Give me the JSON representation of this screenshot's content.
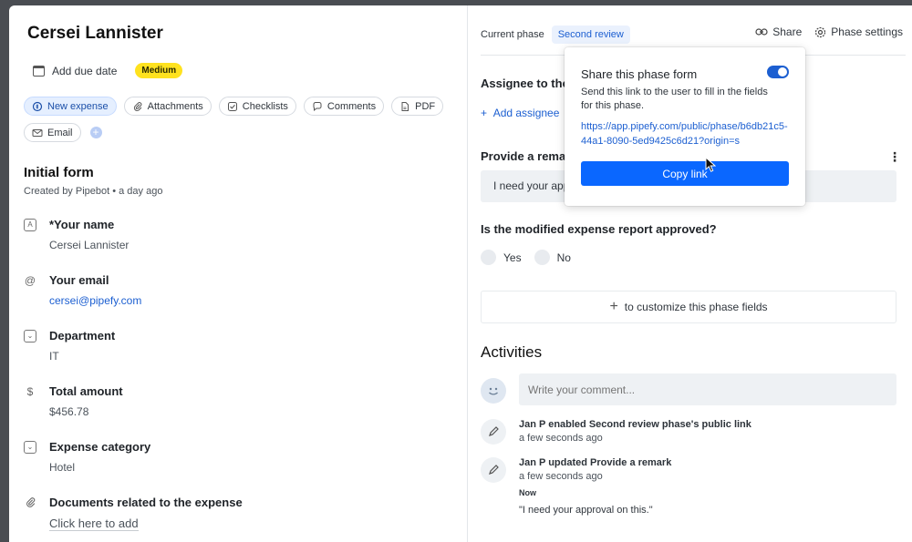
{
  "card": {
    "title": "Cersei Lannister",
    "due_date_label": "Add due date",
    "priority_badge": "Medium"
  },
  "chips": [
    {
      "label": "New expense",
      "icon": "expense-icon",
      "active": true
    },
    {
      "label": "Attachments",
      "icon": "paperclip-icon"
    },
    {
      "label": "Checklists",
      "icon": "checklist-icon"
    },
    {
      "label": "Comments",
      "icon": "comment-icon"
    },
    {
      "label": "PDF",
      "icon": "pdf-icon"
    },
    {
      "label": "Email",
      "icon": "email-icon"
    }
  ],
  "initial_form": {
    "title": "Initial form",
    "created_by": "Created by Pipebot • a day ago",
    "fields": [
      {
        "label": "*Your name",
        "value": "Cersei Lannister",
        "icon": "text-field-icon"
      },
      {
        "label": "Your email",
        "value": "cersei@pipefy.com",
        "icon": "at-icon"
      },
      {
        "label": "Department",
        "value": "IT",
        "icon": "dropdown-field-icon"
      },
      {
        "label": "Total amount",
        "value": "$456.78",
        "icon": "dollar-icon"
      },
      {
        "label": "Expense category",
        "value": "Hotel",
        "icon": "dropdown-field-icon"
      },
      {
        "label": "Documents related to the expense",
        "value": "Click here to add",
        "icon": "paperclip-icon"
      }
    ]
  },
  "phase": {
    "current_label": "Current phase",
    "name": "Second review",
    "share_label": "Share",
    "settings_label": "Phase settings",
    "assignee_label": "Assignee to the",
    "add_assignee_label": "Add assignee",
    "remark_label": "Provide a remar",
    "remark_value": "I need your app",
    "question": "Is the modified expense report approved?",
    "options": [
      "Yes",
      "No"
    ],
    "customize_label": "to customize this phase fields"
  },
  "activities": {
    "title": "Activities",
    "comment_placeholder": "Write your comment...",
    "items": [
      {
        "text": "Jan P enabled Second review phase's public link",
        "time": "a few seconds ago"
      },
      {
        "text": "Jan P updated Provide a remark",
        "time": "a few seconds ago",
        "now": "Now",
        "quote": "\"I need your approval on this.\""
      }
    ]
  },
  "share_popover": {
    "title": "Share this phase form",
    "toggle_on": true,
    "description": "Send this link to the user to fill in the fields for this phase.",
    "link": "https://app.pipefy.com/public/phase/b6db21c5-44a1-8090-5ed9425c6d21?origin=s",
    "copy_button": "Copy link"
  },
  "colors": {
    "accent": "#1c5fd1",
    "button": "#0a67ff",
    "badge": "#ffe21f"
  }
}
